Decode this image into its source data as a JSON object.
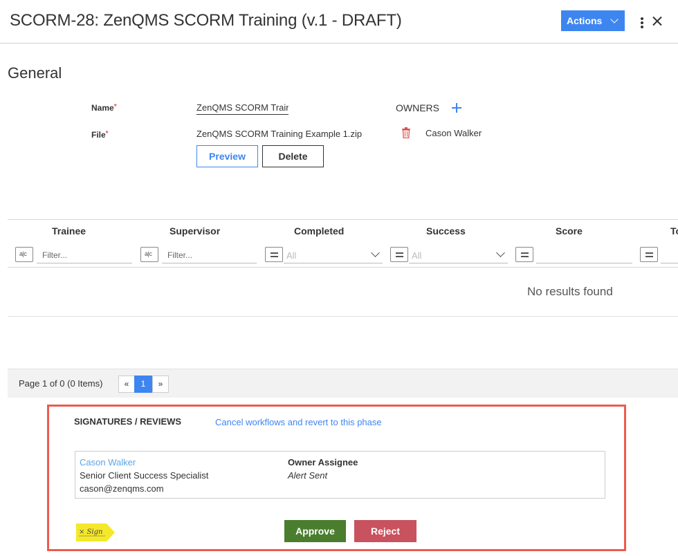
{
  "header": {
    "title": "SCORM-28: ZenQMS SCORM Training (v.1 - DRAFT)",
    "actions_label": "Actions",
    "icons": [
      "more-vertical-icon",
      "close-icon"
    ]
  },
  "general": {
    "section_title": "General",
    "name_label": "Name",
    "name_value": "ZenQMS SCORM Traini",
    "file_label": "File",
    "required_mark": "*",
    "file_name": "ZenQMS SCORM Training Example 1.zip",
    "preview_label": "Preview",
    "delete_label": "Delete",
    "owners_label": "OWNERS",
    "owners": [
      {
        "name": "Cason Walker"
      }
    ]
  },
  "grid": {
    "columns": [
      {
        "label": "Trainee",
        "filter_type": "text",
        "placeholder": "Filter..."
      },
      {
        "label": "Supervisor",
        "filter_type": "text",
        "placeholder": "Filter..."
      },
      {
        "label": "Completed",
        "filter_type": "select",
        "value": "All"
      },
      {
        "label": "Success",
        "filter_type": "select",
        "value": "All"
      },
      {
        "label": "Score",
        "filter_type": "number",
        "value": ""
      },
      {
        "label": "To",
        "filter_type": "number",
        "value": ""
      }
    ],
    "empty_message": "No results found",
    "pager": {
      "summary": "Page 1 of 0 (0 Items)",
      "prev": "«",
      "current": "1",
      "next": "»"
    }
  },
  "signatures": {
    "title": "SIGNATURES / REVIEWS",
    "cancel_link": "Cancel workflows and revert to this phase",
    "entry": {
      "name": "Cason Walker",
      "role": "Senior Client Success Specialist",
      "email": "cason@zenqms.com",
      "assignee_type": "Owner Assignee",
      "status": "Alert Sent"
    },
    "xsign_label": "× Sign",
    "approve_label": "Approve",
    "reject_label": "Reject",
    "colors": {
      "highlight_border": "#ec5b4e",
      "approve": "#4a7d2e",
      "reject": "#c8525e"
    }
  },
  "colors": {
    "accent": "#3d86f0"
  }
}
